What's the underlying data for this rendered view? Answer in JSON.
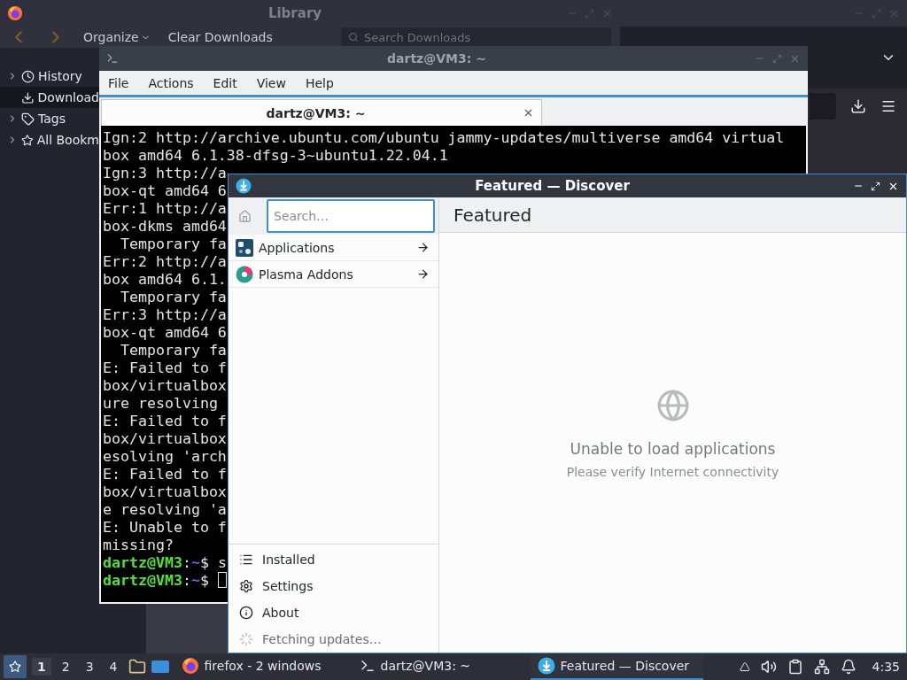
{
  "library": {
    "title": "Library",
    "toolbar": {
      "organize": "Organize",
      "clear": "Clear Downloads",
      "search_placeholder": "Search Downloads"
    },
    "sidebar": [
      {
        "label": "History",
        "kind": "clock",
        "expandable": true,
        "selected": false
      },
      {
        "label": "Download",
        "kind": "download",
        "expandable": false,
        "selected": true
      },
      {
        "label": "Tags",
        "kind": "tag",
        "expandable": true,
        "selected": false
      },
      {
        "label": "All Bookm",
        "kind": "star",
        "expandable": true,
        "selected": false
      }
    ]
  },
  "terminal": {
    "title": "dartz@VM3: ~",
    "menu": [
      "File",
      "Actions",
      "Edit",
      "View",
      "Help"
    ],
    "tab": {
      "label": "dartz@VM3: ~"
    },
    "lines": [
      "Ign:2 http://archive.ubuntu.com/ubuntu jammy-updates/multiverse amd64 virtual",
      "box amd64 6.1.38-dfsg-3~ubuntu1.22.04.1",
      "Ign:3 http://a",
      "box-qt amd64 6",
      "Err:1 http://a",
      "box-dkms amd64",
      "  Temporary fa",
      "Err:2 http://a",
      "box amd64 6.1.",
      "  Temporary fa",
      "Err:3 http://a",
      "box-qt amd64 6",
      "  Temporary fa",
      "E: Failed to f",
      "box/virtualbox",
      "ure resolving",
      "E: Failed to f",
      "box/virtualbox",
      "esolving 'arch",
      "E: Failed to f",
      "box/virtualbox",
      "e resolving 'a",
      "E: Unable to f",
      "missing?"
    ],
    "prompts": [
      {
        "user": "dartz@VM3",
        "sep": ":",
        "path": "~",
        "symbol": "$",
        "command": "s",
        "cursor": false
      },
      {
        "user": "dartz@VM3",
        "sep": ":",
        "path": "~",
        "symbol": "$",
        "cursor": true
      }
    ]
  },
  "discover": {
    "title": "Featured — Discover",
    "search_placeholder": "Search…",
    "categories": [
      {
        "label": "Applications",
        "kind": "apps"
      },
      {
        "label": "Plasma Addons",
        "kind": "addons"
      }
    ],
    "header": "Featured",
    "nav": [
      {
        "label": "Installed",
        "kind": "list",
        "disabled": false
      },
      {
        "label": "Settings",
        "kind": "gear",
        "disabled": false
      },
      {
        "label": "About",
        "kind": "info",
        "disabled": false
      },
      {
        "label": "Fetching updates…",
        "kind": "progress",
        "disabled": true
      }
    ],
    "message": {
      "title": "Unable to load applications",
      "detail": "Please verify Internet connectivity"
    }
  },
  "taskbar": {
    "desktops": [
      {
        "label": "1",
        "selected": true
      },
      {
        "label": "2",
        "selected": false
      },
      {
        "label": "3",
        "selected": false
      },
      {
        "label": "4",
        "selected": false
      }
    ],
    "tasks": [
      {
        "label": "firefox - 2 windows",
        "kind": "firefox",
        "selected": false
      },
      {
        "label": "dartz@VM3: ~",
        "kind": "terminal",
        "selected": false
      },
      {
        "label": "Featured — Discover",
        "kind": "discover",
        "selected": true
      }
    ],
    "clock": "4:35"
  }
}
